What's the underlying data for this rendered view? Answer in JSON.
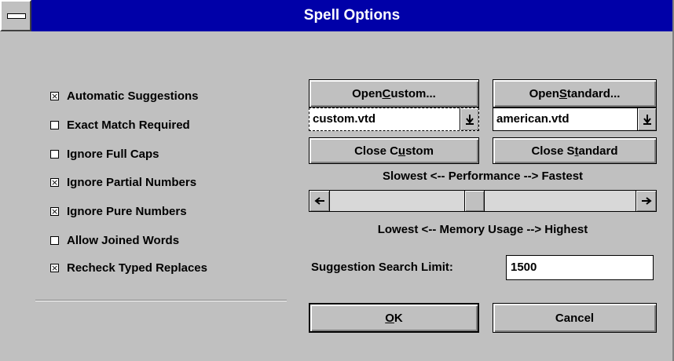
{
  "window": {
    "title": "Spell Options"
  },
  "options": [
    {
      "label": "Automatic Suggestions",
      "checked": true
    },
    {
      "label": "Exact Match Required",
      "checked": false
    },
    {
      "label": "Ignore Full Caps",
      "checked": false
    },
    {
      "label": "Ignore Partial Numbers",
      "checked": true
    },
    {
      "label": "Ignore Pure Numbers",
      "checked": true
    },
    {
      "label": "Allow Joined Words",
      "checked": false
    },
    {
      "label": "Recheck Typed Replaces",
      "checked": true
    }
  ],
  "custom": {
    "open_label": "Open Custom...",
    "file": "custom.vtd",
    "close_label": "Close Custom"
  },
  "standard": {
    "open_label": "Open Standard...",
    "file": "american.vtd",
    "close_label": "Close Standard"
  },
  "tuning": {
    "performance_label": "Slowest <-- Performance --> Fastest",
    "memory_label": "Lowest <-- Memory Usage --> Highest",
    "slider_level": 0.47
  },
  "search_limit": {
    "label": "Suggestion Search Limit:",
    "value": "1500"
  },
  "buttons": {
    "ok": "OK",
    "cancel": "Cancel"
  },
  "colors": {
    "titlebar": "#0000a8",
    "face": "#c0c0c0"
  },
  "icons": {
    "system_menu": "system-menu-icon",
    "dropdown": "down-arrow-icon",
    "scroll_left": "left-arrow-icon",
    "scroll_right": "right-arrow-icon"
  }
}
